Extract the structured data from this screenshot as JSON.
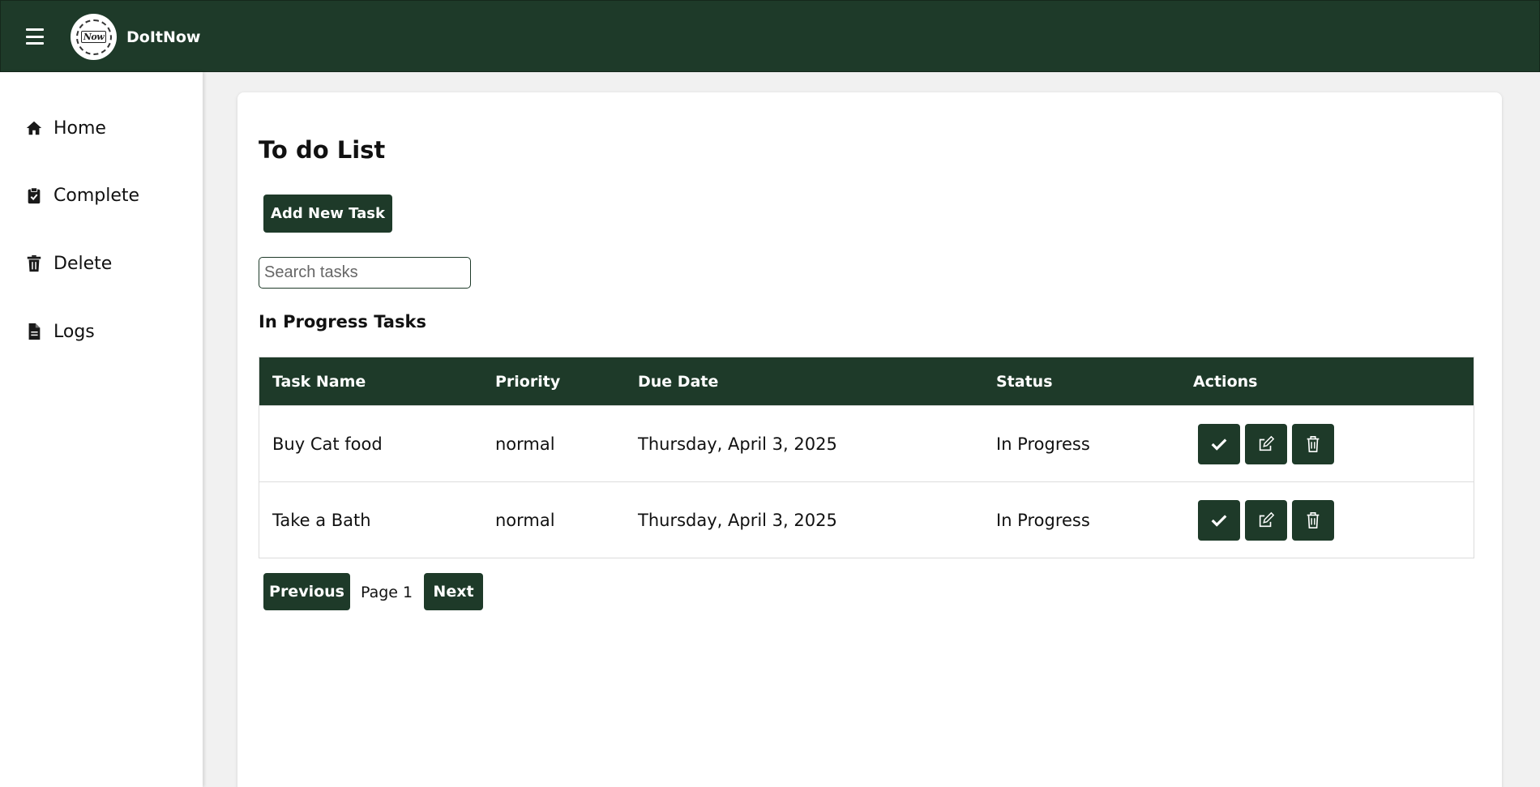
{
  "header": {
    "brand": "DoItNow",
    "logo_text": "Now"
  },
  "sidebar": {
    "items": [
      {
        "label": "Home",
        "icon": "home-icon"
      },
      {
        "label": "Complete",
        "icon": "clipboard-check-icon"
      },
      {
        "label": "Delete",
        "icon": "trash-icon"
      },
      {
        "label": "Logs",
        "icon": "file-icon"
      }
    ]
  },
  "main": {
    "title": "To do List",
    "add_button": "Add New Task",
    "search_placeholder": "Search tasks",
    "search_value": "",
    "section_title": "In Progress Tasks",
    "table": {
      "headers": [
        "Task Name",
        "Priority",
        "Due Date",
        "Status",
        "Actions"
      ],
      "rows": [
        {
          "name": "Buy Cat food",
          "priority": "normal",
          "due": "Thursday, April 3, 2025",
          "status": "In Progress"
        },
        {
          "name": "Take a Bath",
          "priority": "normal",
          "due": "Thursday, April 3, 2025",
          "status": "In Progress"
        }
      ]
    },
    "pagination": {
      "previous": "Previous",
      "page": "Page 1",
      "next": "Next"
    }
  },
  "colors": {
    "primary": "#1e3a29",
    "background": "#f1f1f1",
    "card": "#ffffff"
  }
}
